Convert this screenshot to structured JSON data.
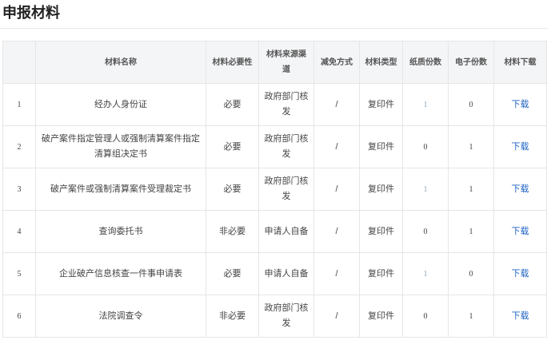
{
  "page": {
    "title": "申报材料"
  },
  "table": {
    "columns": [
      "材料名称",
      "材料必要性",
      "材料来源渠道",
      "减免方式",
      "材料类型",
      "纸质份数",
      "电子份数",
      "材料下载"
    ],
    "rows": [
      {
        "index": "1",
        "name": "经办人身份证",
        "required": "必要",
        "source": "政府部门核发",
        "exemption": "/",
        "type": "复印件",
        "paper": "1",
        "electronic": "0",
        "download": "下载"
      },
      {
        "index": "2",
        "name": "破产案件指定管理人或强制清算案件指定清算组决定书",
        "required": "必要",
        "source": "政府部门核发",
        "exemption": "/",
        "type": "复印件",
        "paper": "0",
        "electronic": "1",
        "download": "下载"
      },
      {
        "index": "3",
        "name": "破产案件或强制清算案件受理裁定书",
        "required": "必要",
        "source": "政府部门核发",
        "exemption": "/",
        "type": "复印件",
        "paper": "1",
        "electronic": "1",
        "download": "下载"
      },
      {
        "index": "4",
        "name": "查询委托书",
        "required": "非必要",
        "source": "申请人自备",
        "exemption": "/",
        "type": "复印件",
        "paper": "0",
        "electronic": "1",
        "download": "下载"
      },
      {
        "index": "5",
        "name": "企业破产信息核查一件事申请表",
        "required": "必要",
        "source": "申请人自备",
        "exemption": "/",
        "type": "复印件",
        "paper": "1",
        "electronic": "0",
        "download": "下载"
      },
      {
        "index": "6",
        "name": "法院调查令",
        "required": "非必要",
        "source": "政府部门核发",
        "exemption": "/",
        "type": "复印件",
        "paper": "0",
        "electronic": "1",
        "download": "下载"
      }
    ]
  }
}
